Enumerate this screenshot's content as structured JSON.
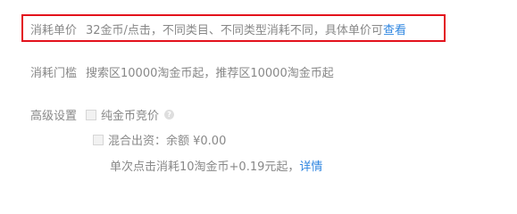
{
  "unit_price": {
    "label": "消耗单价",
    "text": "32金币/点击，不同类目、不同类型消耗不同，具体单价可",
    "link": "查看"
  },
  "threshold": {
    "label": "消耗门槛",
    "text": "搜索区10000淘金币起，推荐区10000淘金币起"
  },
  "advanced": {
    "label": "高级设置",
    "option1_label": "纯金币竞价",
    "option1_help": "?",
    "option2_label": "混合出资：余额 ¥0.00",
    "option2_note": "单次点击消耗10淘金币+0.19元起，",
    "option2_link": "详情"
  },
  "colors": {
    "highlight_border": "#e3121c",
    "link": "#2f86e0"
  }
}
